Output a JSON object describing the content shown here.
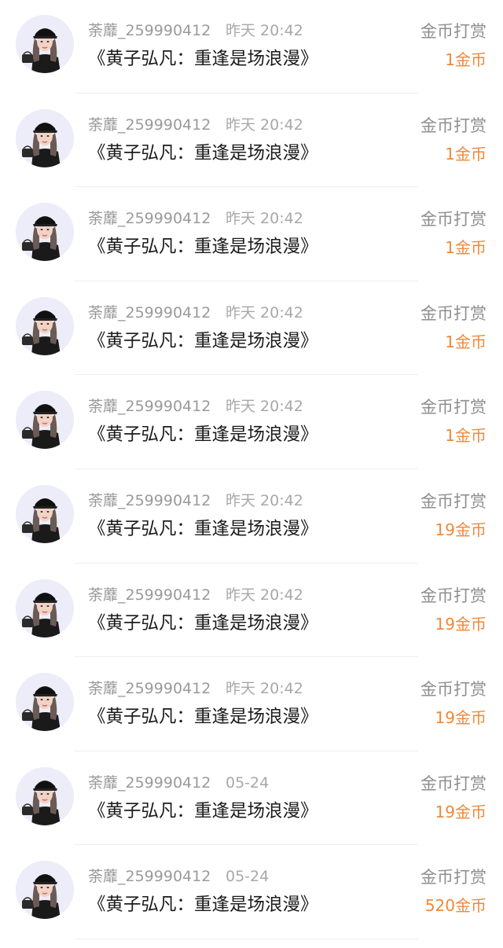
{
  "records": [
    {
      "username": "荼蘼_259990412",
      "time": "昨天 20:42",
      "title": "《黄子弘凡：重逢是场浪漫》",
      "type": "金币打赏",
      "amount": "1金币"
    },
    {
      "username": "荼蘼_259990412",
      "time": "昨天 20:42",
      "title": "《黄子弘凡：重逢是场浪漫》",
      "type": "金币打赏",
      "amount": "1金币"
    },
    {
      "username": "荼蘼_259990412",
      "time": "昨天 20:42",
      "title": "《黄子弘凡：重逢是场浪漫》",
      "type": "金币打赏",
      "amount": "1金币"
    },
    {
      "username": "荼蘼_259990412",
      "time": "昨天 20:42",
      "title": "《黄子弘凡：重逢是场浪漫》",
      "type": "金币打赏",
      "amount": "1金币"
    },
    {
      "username": "荼蘼_259990412",
      "time": "昨天 20:42",
      "title": "《黄子弘凡：重逢是场浪漫》",
      "type": "金币打赏",
      "amount": "1金币"
    },
    {
      "username": "荼蘼_259990412",
      "time": "昨天 20:42",
      "title": "《黄子弘凡：重逢是场浪漫》",
      "type": "金币打赏",
      "amount": "19金币"
    },
    {
      "username": "荼蘼_259990412",
      "time": "昨天 20:42",
      "title": "《黄子弘凡：重逢是场浪漫》",
      "type": "金币打赏",
      "amount": "19金币"
    },
    {
      "username": "荼蘼_259990412",
      "time": "昨天 20:42",
      "title": "《黄子弘凡：重逢是场浪漫》",
      "type": "金币打赏",
      "amount": "19金币"
    },
    {
      "username": "荼蘼_259990412",
      "time": "05-24",
      "title": "《黄子弘凡：重逢是场浪漫》",
      "type": "金币打赏",
      "amount": "19金币"
    },
    {
      "username": "荼蘼_259990412",
      "time": "05-24",
      "title": "《黄子弘凡：重逢是场浪漫》",
      "type": "金币打赏",
      "amount": "520金币"
    }
  ],
  "avatar_icon": "user-avatar-photo",
  "colors": {
    "amount": "#f0883a",
    "username": "#9a9a9a",
    "title": "#1b1b1b",
    "divider": "#eeeeee"
  }
}
